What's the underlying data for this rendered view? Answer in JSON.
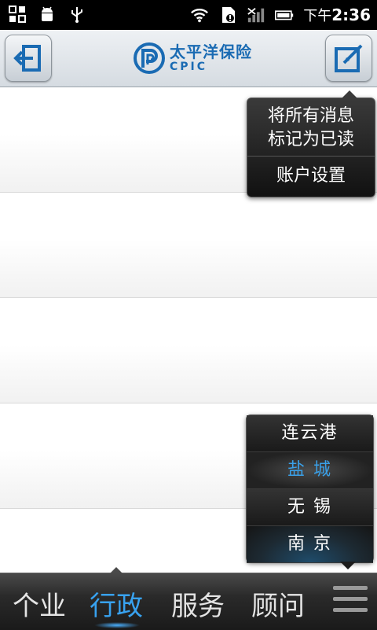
{
  "status_bar": {
    "time_prefix": "下午",
    "time": "2:36",
    "icons": [
      "grid-icon",
      "android-icon",
      "usb-icon",
      "wifi-icon",
      "sd-card-alert-icon",
      "signal-icon",
      "battery-icon"
    ]
  },
  "header": {
    "logo_cn": "太平洋保险",
    "logo_en": "CPIC",
    "left_button_icon": "logout-icon",
    "right_button_icon": "compose-icon",
    "accent_color": "#1a6bb3"
  },
  "top_menu": {
    "items": [
      {
        "label": "将所有消息\n标记为已读"
      },
      {
        "label": "账户设置"
      }
    ]
  },
  "city_menu": {
    "items": [
      {
        "label": "连云港",
        "state": "normal"
      },
      {
        "label": "盐 城",
        "state": "selected"
      },
      {
        "label": "无 锡",
        "state": "normal"
      },
      {
        "label": "南 京",
        "state": "highlighted"
      }
    ],
    "selected_color": "#3aa0e8"
  },
  "bottom_nav": {
    "tabs": [
      {
        "label": "个业",
        "active": false
      },
      {
        "label": "行政",
        "active": true
      },
      {
        "label": "服务",
        "active": false
      },
      {
        "label": "顾问",
        "active": false
      }
    ],
    "active_color": "#38a2f0",
    "menu_icon": "menu-icon"
  }
}
